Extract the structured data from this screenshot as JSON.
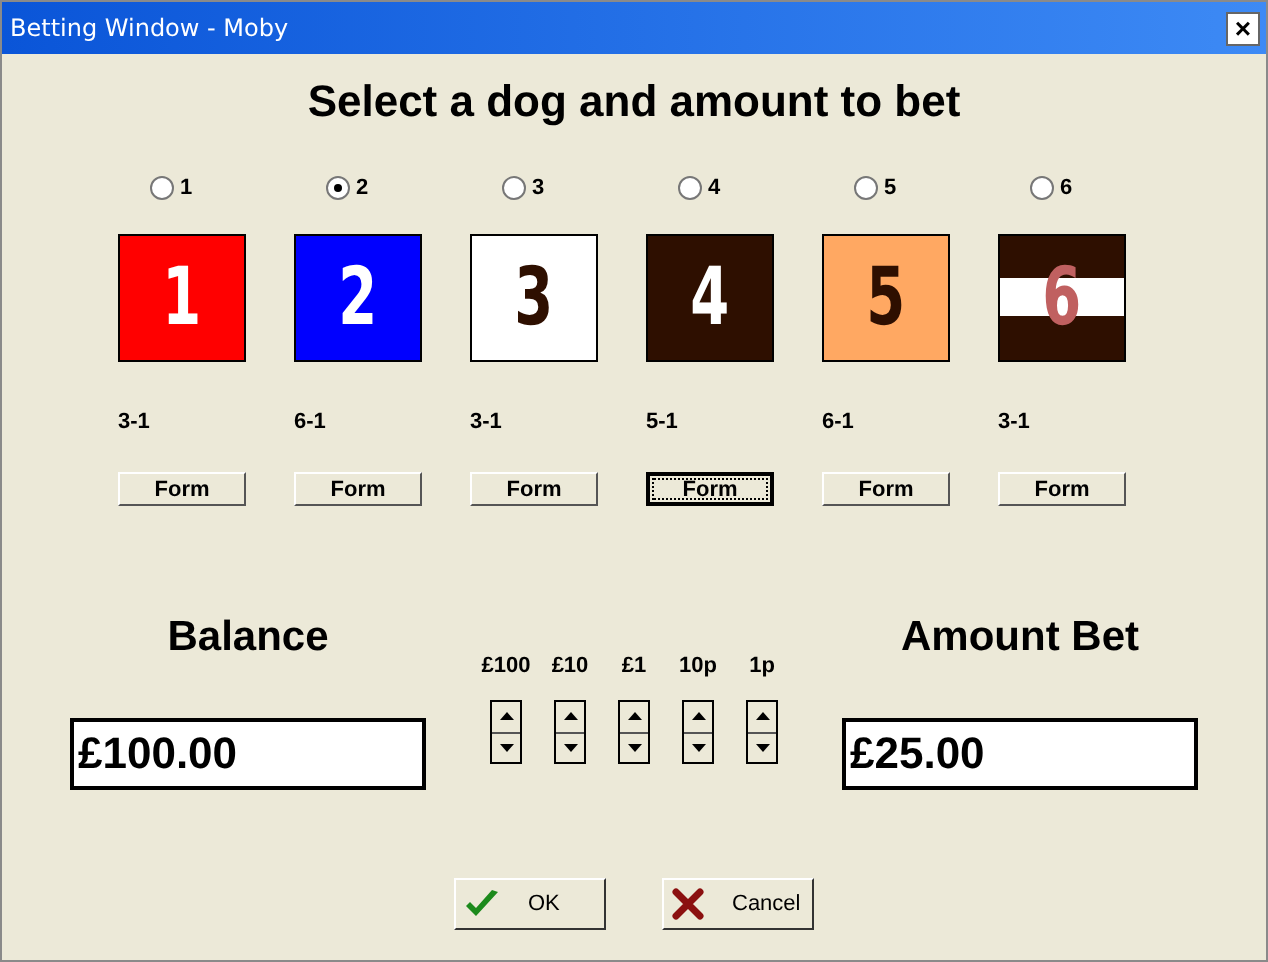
{
  "window": {
    "title": "Betting Window - Moby",
    "close": "×"
  },
  "heading": "Select a dog and amount to bet",
  "dogs": [
    {
      "label": "1",
      "selected": false,
      "number": {
        "text": "1",
        "color": "#ffffff"
      },
      "color": "#ff0000",
      "kind": "plain",
      "odds": "3-1",
      "form": "Form",
      "focused": false
    },
    {
      "label": "2",
      "selected": true,
      "number": {
        "text": "2",
        "color": "#ffffff"
      },
      "color": "#0000ff",
      "kind": "plain",
      "odds": "6-1",
      "form": "Form",
      "focused": false
    },
    {
      "label": "3",
      "selected": false,
      "number": {
        "text": "3",
        "color": "#2e0f00"
      },
      "color": "#ffffff",
      "kind": "plain",
      "odds": "3-1",
      "form": "Form",
      "focused": false
    },
    {
      "label": "4",
      "selected": false,
      "number": {
        "text": "4",
        "color": "#ffffff"
      },
      "color": "#2e0f00",
      "kind": "plain",
      "odds": "5-1",
      "form": "Form",
      "focused": true
    },
    {
      "label": "5",
      "selected": false,
      "number": {
        "text": "5",
        "color": "#2e0f00"
      },
      "color": "#ffa862",
      "kind": "plain",
      "odds": "6-1",
      "form": "Form",
      "focused": false
    },
    {
      "label": "6",
      "selected": false,
      "number": {
        "text": "6",
        "color": "#c06060"
      },
      "color": "#2e0f00",
      "kind": "striped",
      "odds": "3-1",
      "form": "Form",
      "focused": false
    }
  ],
  "balance": {
    "label": "Balance",
    "value": "£100.00"
  },
  "steppers": [
    "£100",
    "£10",
    "£1",
    "10p",
    "1p"
  ],
  "amount_bet": {
    "label": "Amount Bet",
    "value": "£25.00"
  },
  "buttons": [
    {
      "kind": "ok",
      "label": "OK"
    },
    {
      "kind": "cancel",
      "label": "Cancel"
    }
  ]
}
